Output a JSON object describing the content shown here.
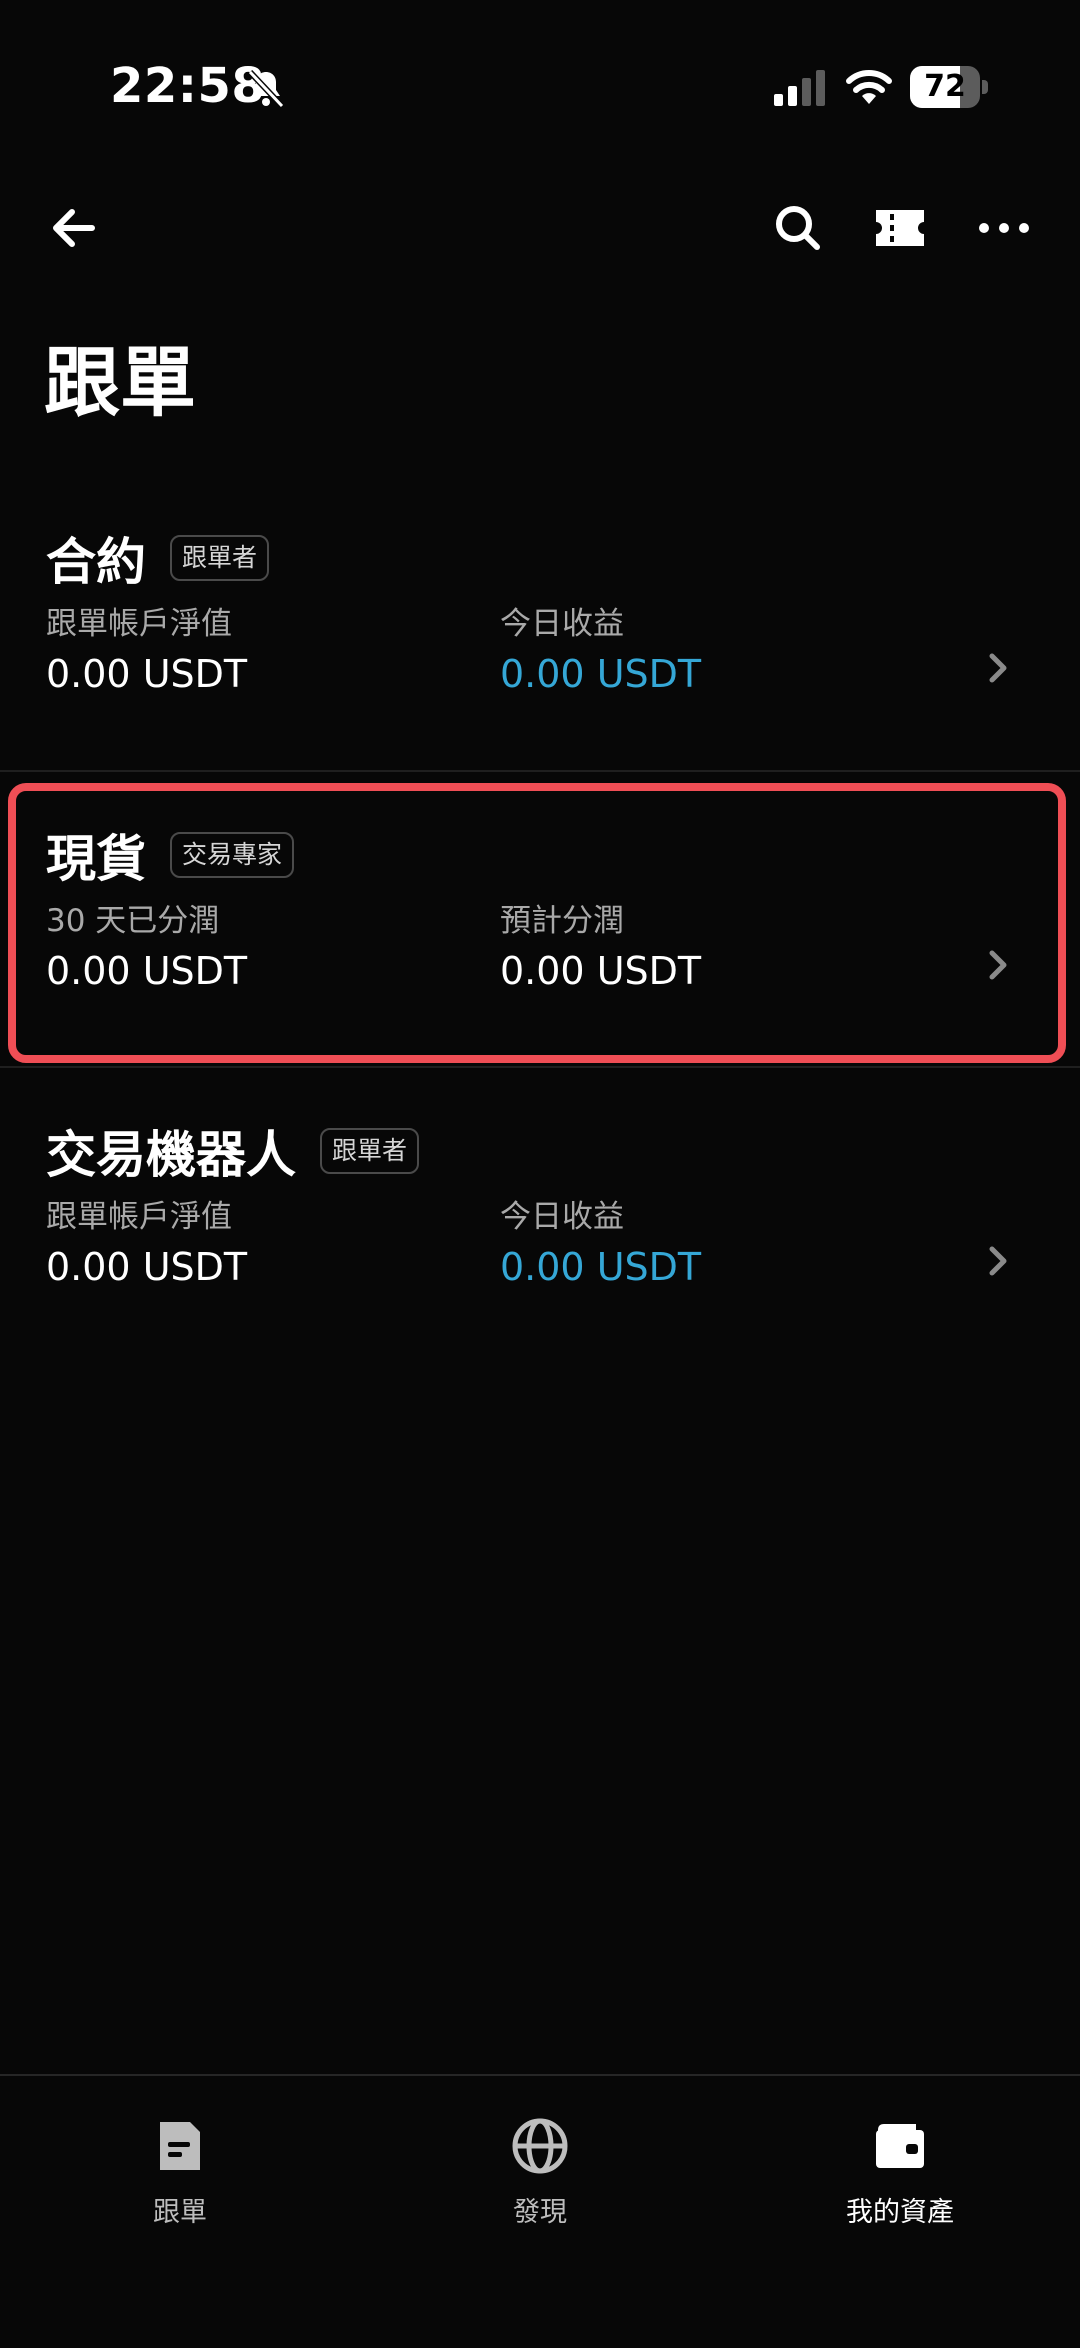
{
  "status_bar": {
    "time": "22:58",
    "battery_percent": "72",
    "battery_level": 0.72
  },
  "header": {
    "back_icon": "arrow-left-icon",
    "search_icon": "search-icon",
    "ticket_icon": "ticket-icon",
    "more_icon": "more-icon"
  },
  "page": {
    "title": "跟單"
  },
  "sections": [
    {
      "title": "合約",
      "badge": "跟單者",
      "left_label": "跟單帳戶淨值",
      "left_value": "0.00 USDT",
      "right_label": "今日收益",
      "right_value": "0.00 USDT"
    },
    {
      "title": "現貨",
      "badge": "交易專家",
      "left_label": "30 天已分潤",
      "left_value": "0.00 USDT",
      "right_label": "預計分潤",
      "right_value": "0.00 USDT"
    },
    {
      "title": "交易機器人",
      "badge": "跟單者",
      "left_label": "跟單帳戶淨值",
      "left_value": "0.00 USDT",
      "right_label": "今日收益",
      "right_value": "0.00 USDT"
    }
  ],
  "bottom_nav": {
    "items": [
      {
        "label": "跟單",
        "icon": "document-icon"
      },
      {
        "label": "發現",
        "icon": "globe-icon"
      },
      {
        "label": "我的資產",
        "icon": "wallet-icon"
      }
    ],
    "active": 2
  },
  "colors": {
    "background": "#070707",
    "accent": "#35a7d6",
    "highlight": "#ef4e55"
  }
}
